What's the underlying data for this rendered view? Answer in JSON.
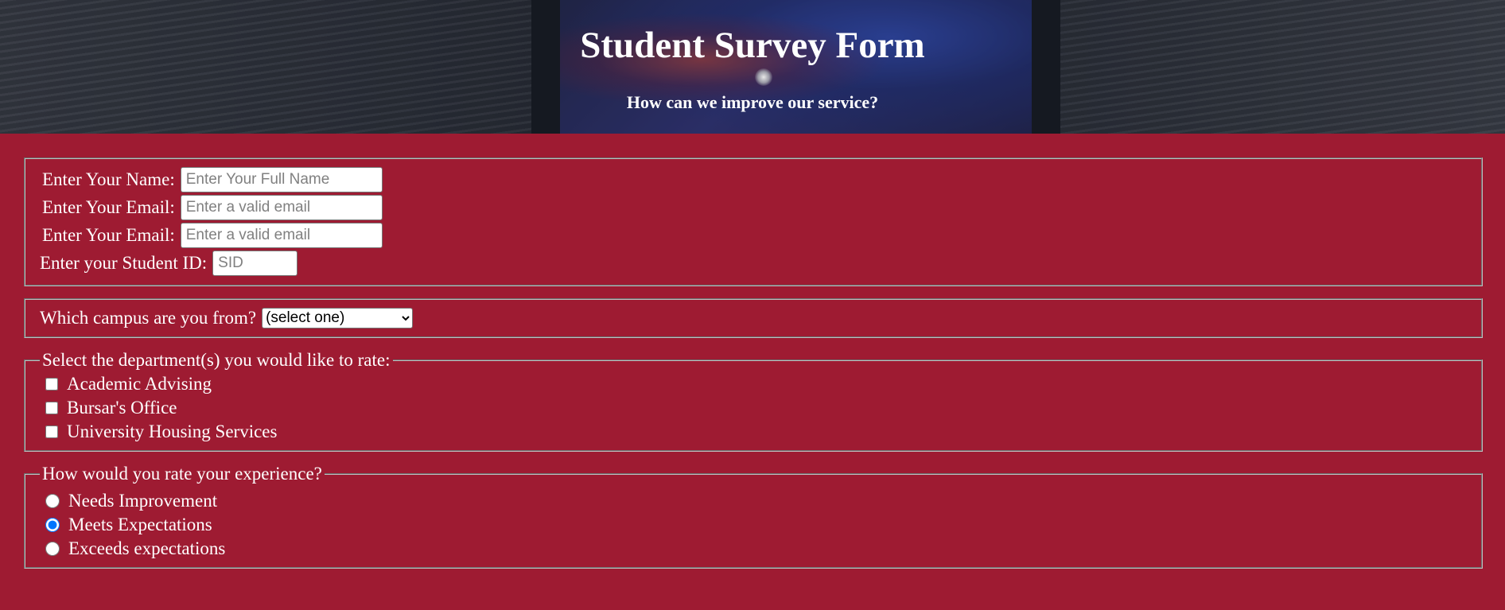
{
  "header": {
    "title": "Student Survey Form",
    "subtitle": "How can we improve our service?"
  },
  "personal": {
    "name_label": "Enter Your Name:",
    "name_placeholder": "Enter Your Full Name",
    "email_label": "Enter Your Email:",
    "email_placeholder": "Enter a valid email",
    "email2_label": "Enter Your Email:",
    "email2_placeholder": "Enter a valid email",
    "sid_label": "Enter your Student ID:",
    "sid_placeholder": "SID"
  },
  "campus": {
    "label": "Which campus are you from?",
    "selected": "(select one)"
  },
  "departments": {
    "legend": "Select the department(s) you would like to rate:",
    "items": [
      {
        "label": "Academic Advising",
        "checked": false
      },
      {
        "label": "Bursar's Office",
        "checked": false
      },
      {
        "label": "University Housing Services",
        "checked": false
      }
    ]
  },
  "rating": {
    "legend": "How would you rate your experience?",
    "options": [
      {
        "label": "Needs Improvement",
        "selected": false
      },
      {
        "label": "Meets Expectations",
        "selected": true
      },
      {
        "label": "Exceeds expectations",
        "selected": false
      }
    ]
  },
  "colors": {
    "background": "#9e1b32",
    "text": "#ffffff"
  }
}
